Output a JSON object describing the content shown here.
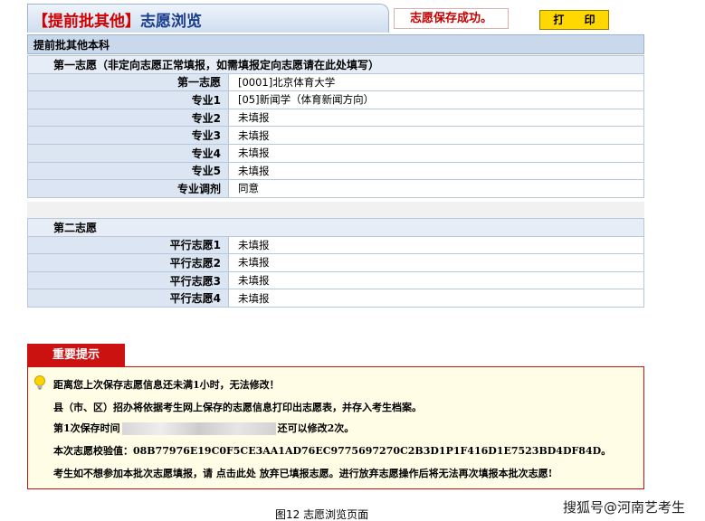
{
  "header": {
    "title_prefix": "【提前批其他】",
    "title_main": "志愿浏览",
    "save_message": "志愿保存成功。",
    "print_label": "打 印"
  },
  "category": "提前批其他本科",
  "first_choice": {
    "heading": "第一志愿（非定向志愿正常填报，如需填报定向志愿请在此处填写）",
    "rows": [
      {
        "label": "第一志愿",
        "value": "[0001]北京体育大学"
      },
      {
        "label": "专业1",
        "value": "[05]新闻学（体育新闻方向）"
      },
      {
        "label": "专业2",
        "value": "未填报"
      },
      {
        "label": "专业3",
        "value": "未填报"
      },
      {
        "label": "专业4",
        "value": "未填报"
      },
      {
        "label": "专业5",
        "value": "未填报"
      },
      {
        "label": "专业调剂",
        "value": "同意"
      }
    ]
  },
  "second_choice": {
    "heading": "第二志愿",
    "rows": [
      {
        "label": "平行志愿1",
        "value": "未填报"
      },
      {
        "label": "平行志愿2",
        "value": "未填报"
      },
      {
        "label": "平行志愿3",
        "value": "未填报"
      },
      {
        "label": "平行志愿4",
        "value": "未填报"
      }
    ]
  },
  "notice": {
    "tab": "重要提示",
    "line1": "距离您上次保存志愿信息还未满1小时，无法修改！",
    "line2": "县（市、区）招办将依据考生网上保存的志愿信息打印出志愿表，并存入考生档案。",
    "line3_prefix": "第1次保存时间",
    "line3_suffix": "还可以修改2次。",
    "line4": "本次志愿校验值：08B77976E19C0F5CE3AA1AD76EC9775697270C2B3D1P1F416D1E7523BD4DF84D。",
    "line5_a": "考生如不想参加本批次志愿填报，请",
    "line5_link": "点击此处",
    "line5_b": "放弃已填报志愿。进行放弃志愿操作后将无法再次填报本批次志愿!"
  },
  "caption": "图12 志愿浏览页面",
  "watermark": "搜狐号@河南艺考生",
  "colors": {
    "accent_red": "#cc1111",
    "header_blue": "#1a3d8f",
    "print_yellow": "#ffd800"
  }
}
